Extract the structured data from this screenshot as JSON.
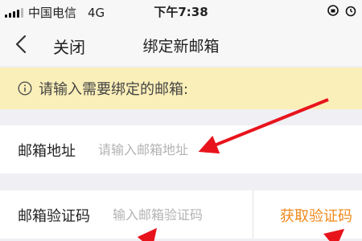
{
  "status_bar": {
    "carrier": "中国电信",
    "network": "4G",
    "time": "下午7:38"
  },
  "nav": {
    "back_icon": "chevron-left-icon",
    "close_label": "关闭",
    "title": "绑定新邮箱"
  },
  "notice": {
    "icon": "info-icon",
    "text": "请输入需要绑定的邮箱:"
  },
  "form": {
    "email_label": "邮箱地址",
    "email_placeholder": "请输入邮箱地址",
    "email_value": "",
    "code_label": "邮箱验证码",
    "code_placeholder": "输入邮箱验证码",
    "code_value": "",
    "get_code_label": "获取验证码"
  },
  "colors": {
    "notice_bg": "#fbefb9",
    "accent": "#f08a1c",
    "annotation_arrow": "#e8141c"
  }
}
